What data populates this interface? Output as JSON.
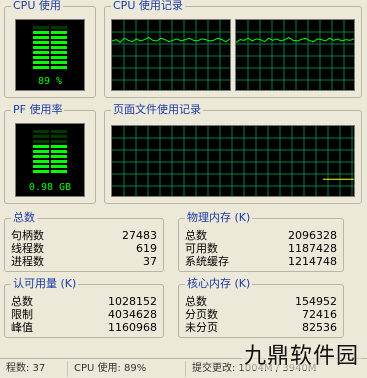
{
  "cpu_usage": {
    "title": "CPU 使用",
    "value_label": "89 %",
    "level": 0.89
  },
  "cpu_history": {
    "title": "CPU 使用记录",
    "graph1": [
      70,
      72,
      68,
      74,
      71,
      69,
      73,
      70,
      72,
      75,
      71,
      70,
      74,
      72,
      69,
      71,
      73,
      70,
      72,
      74,
      71,
      70,
      73,
      72,
      70,
      71,
      74,
      72,
      69,
      73
    ],
    "graph2": [
      68,
      72,
      71,
      74,
      70,
      73,
      72,
      69,
      74,
      71,
      73,
      70,
      72,
      75,
      71,
      70,
      72,
      74,
      71,
      69,
      73,
      72,
      70,
      74,
      71,
      73,
      70,
      72,
      71,
      73
    ]
  },
  "pf_usage": {
    "title": "PF 使用率",
    "value_label": "0.98 GB",
    "level": 0.62
  },
  "pf_history": {
    "title": "页面文件使用记录",
    "line": [
      0,
      0,
      0,
      0,
      0,
      0,
      0,
      0,
      0,
      0,
      0,
      0,
      0,
      0,
      0,
      0,
      0,
      0,
      0,
      0,
      0,
      0,
      0,
      0,
      0,
      0,
      0,
      0,
      0,
      0,
      0,
      0,
      0,
      0,
      0.24,
      0.24,
      0.24,
      0.24,
      0.24,
      0.24
    ]
  },
  "totals": {
    "title": "总数",
    "rows": [
      {
        "label": "句柄数",
        "value": "27483"
      },
      {
        "label": "线程数",
        "value": "619"
      },
      {
        "label": "进程数",
        "value": "37"
      }
    ]
  },
  "physical_memory": {
    "title": "物理内存 (K)",
    "rows": [
      {
        "label": "总数",
        "value": "2096328"
      },
      {
        "label": "可用数",
        "value": "1187428"
      },
      {
        "label": "系统缓存",
        "value": "1214748"
      }
    ]
  },
  "commit_charge": {
    "title": "认可用量 (K)",
    "rows": [
      {
        "label": "总数",
        "value": "1028152"
      },
      {
        "label": "限制",
        "value": "4034628"
      },
      {
        "label": "峰值",
        "value": "1160968"
      }
    ]
  },
  "kernel_memory": {
    "title": "核心内存 (K)",
    "rows": [
      {
        "label": "总数",
        "value": "154952"
      },
      {
        "label": "分页数",
        "value": "72416"
      },
      {
        "label": "未分页",
        "value": "82536"
      }
    ]
  },
  "statusbar": {
    "processes": "程数: 37",
    "cpu": "CPU 使用: 89%",
    "commit": "提交更改: 1004M / 3940M"
  },
  "watermark": "九鼎软件园",
  "colors": {
    "grid": "#008040",
    "graph_line": "#00ff00",
    "pf_line": "#ffff00",
    "title_blue": "#1d3aa8"
  }
}
